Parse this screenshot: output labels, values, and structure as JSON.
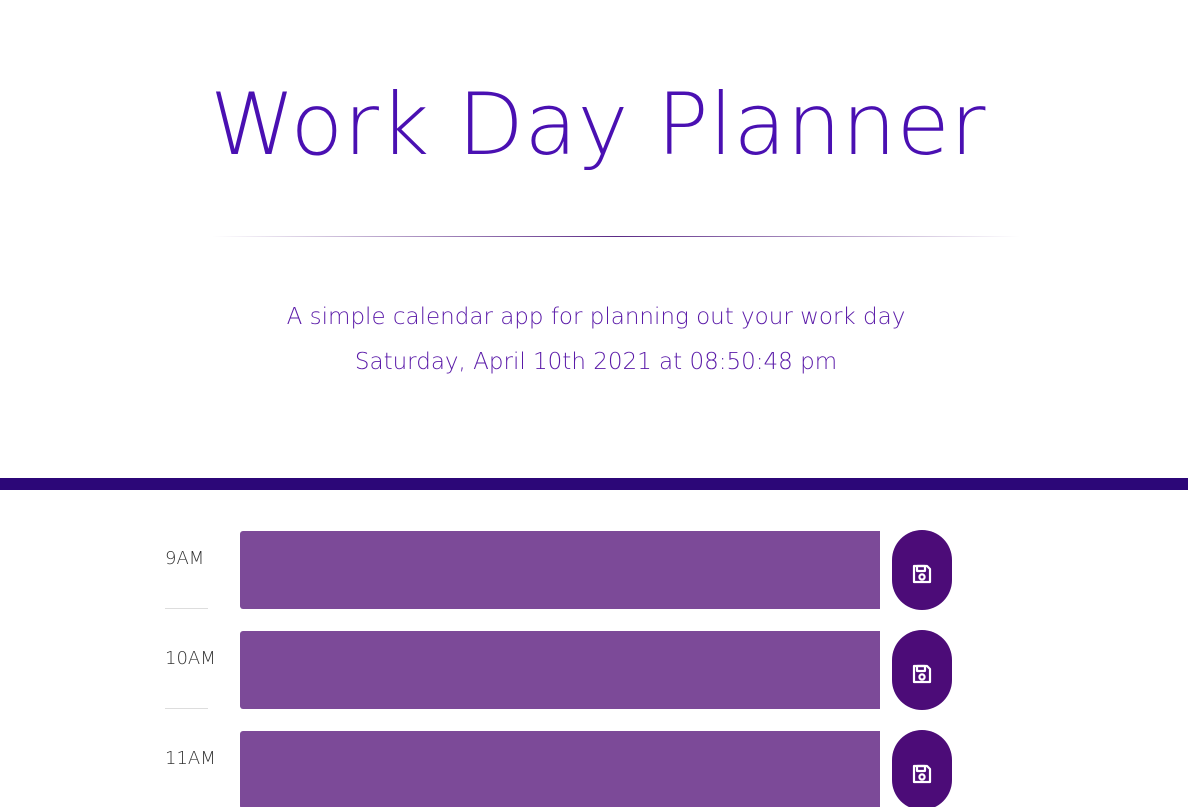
{
  "header": {
    "title": "Work Day Planner",
    "subtitle": "A simple calendar app for planning out your work day",
    "datetime": "Saturday, April 10th 2021 at 08:50:48 pm"
  },
  "planner": {
    "rows": [
      {
        "hour": "9AM",
        "task": "",
        "save_icon": "save-icon"
      },
      {
        "hour": "10AM",
        "task": "",
        "save_icon": "save-icon"
      },
      {
        "hour": "11AM",
        "task": "",
        "save_icon": "save-icon"
      }
    ]
  },
  "colors": {
    "title": "#4a10b2",
    "accent_bar": "#2c0778",
    "row_past": "#7c4a98",
    "save_button": "#4c0c78"
  }
}
